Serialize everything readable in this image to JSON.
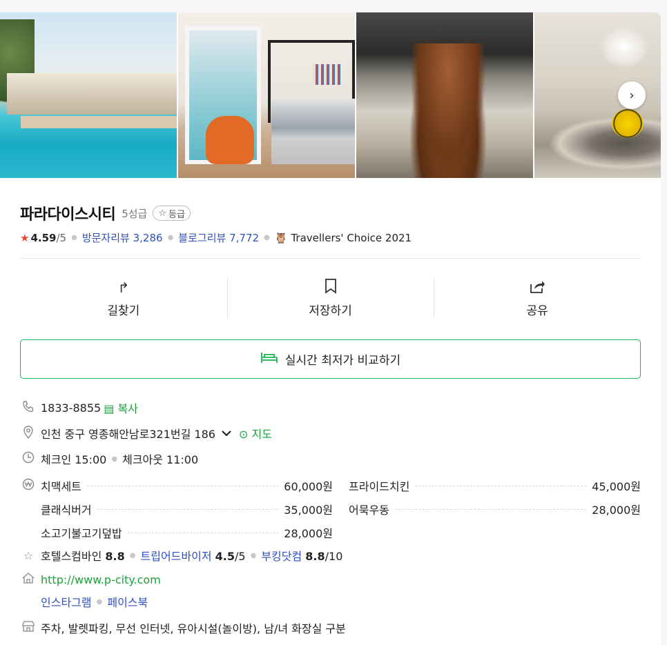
{
  "hotel": {
    "name": "파라다이스시티",
    "grade": "5성급",
    "grade_badge": "등급",
    "rating": "4.59",
    "rating_max": "/5",
    "visitor_reviews_label": "방문자리뷰",
    "visitor_reviews_count": "3,286",
    "blog_reviews_label": "블로그리뷰",
    "blog_reviews_count": "7,772",
    "award": "Travellers' Choice 2021"
  },
  "photos": [
    "pool",
    "bedroom",
    "lobby-sculpture",
    "atrium"
  ],
  "actions": {
    "directions": "길찾기",
    "save": "저장하기",
    "share": "공유"
  },
  "compare_button": "실시간 최저가 비교하기",
  "phone": {
    "number": "1833-8855",
    "copy": "복사"
  },
  "address": {
    "text": "인천 중구 영종해안남로321번길 186",
    "map_link": "지도"
  },
  "hours": {
    "checkin": "체크인 15:00",
    "checkout": "체크아웃 11:00"
  },
  "menu": [
    {
      "name": "치맥세트",
      "price": "60,000원"
    },
    {
      "name": "프라이드치킨",
      "price": "45,000원"
    },
    {
      "name": "클래식버거",
      "price": "35,000원"
    },
    {
      "name": "어묵우동",
      "price": "28,000원"
    },
    {
      "name": "소고기불고기덮밥",
      "price": "28,000원"
    }
  ],
  "external_ratings": [
    {
      "site": "호텔스컴바인",
      "score": "8.8",
      "max": ""
    },
    {
      "site": "트립어드바이저",
      "score": "4.5",
      "max": "/5"
    },
    {
      "site": "부킹닷컴",
      "score": "8.8",
      "max": "/10"
    }
  ],
  "website": "http://www.p-city.com",
  "social": {
    "instagram": "인스타그램",
    "facebook": "페이스북"
  },
  "facilities": "주차, 발렛파킹, 무선 인터넷, 유아시설(놀이방), 남/녀 화장실 구분",
  "colors": {
    "accent_green": "#19b34a",
    "link_blue": "#2e4fbf",
    "star_red": "#e5462f"
  }
}
